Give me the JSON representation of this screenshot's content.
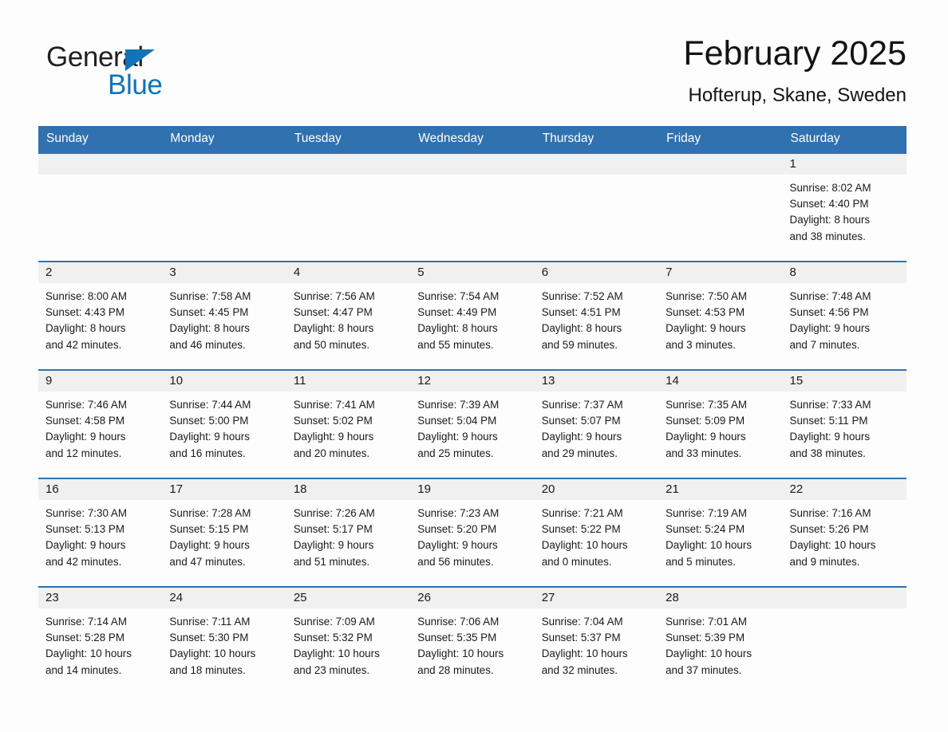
{
  "brand": {
    "word_one": "General",
    "word_two": "Blue",
    "triangle_color": "#1273b8"
  },
  "header": {
    "title": "February 2025",
    "subtitle": "Hofterup, Skane, Sweden"
  },
  "theme": {
    "header_blue": "#3071b0",
    "daynum_band": "#f0f0f0",
    "page_bg": "#fdfdfd",
    "text": "#1a1a1a"
  },
  "weekdays": [
    "Sunday",
    "Monday",
    "Tuesday",
    "Wednesday",
    "Thursday",
    "Friday",
    "Saturday"
  ],
  "weeks": [
    [
      {
        "day": "",
        "lines": []
      },
      {
        "day": "",
        "lines": []
      },
      {
        "day": "",
        "lines": []
      },
      {
        "day": "",
        "lines": []
      },
      {
        "day": "",
        "lines": []
      },
      {
        "day": "",
        "lines": []
      },
      {
        "day": "1",
        "lines": [
          "Sunrise: 8:02 AM",
          "Sunset: 4:40 PM",
          "Daylight: 8 hours",
          "and 38 minutes."
        ]
      }
    ],
    [
      {
        "day": "2",
        "lines": [
          "Sunrise: 8:00 AM",
          "Sunset: 4:43 PM",
          "Daylight: 8 hours",
          "and 42 minutes."
        ]
      },
      {
        "day": "3",
        "lines": [
          "Sunrise: 7:58 AM",
          "Sunset: 4:45 PM",
          "Daylight: 8 hours",
          "and 46 minutes."
        ]
      },
      {
        "day": "4",
        "lines": [
          "Sunrise: 7:56 AM",
          "Sunset: 4:47 PM",
          "Daylight: 8 hours",
          "and 50 minutes."
        ]
      },
      {
        "day": "5",
        "lines": [
          "Sunrise: 7:54 AM",
          "Sunset: 4:49 PM",
          "Daylight: 8 hours",
          "and 55 minutes."
        ]
      },
      {
        "day": "6",
        "lines": [
          "Sunrise: 7:52 AM",
          "Sunset: 4:51 PM",
          "Daylight: 8 hours",
          "and 59 minutes."
        ]
      },
      {
        "day": "7",
        "lines": [
          "Sunrise: 7:50 AM",
          "Sunset: 4:53 PM",
          "Daylight: 9 hours",
          "and 3 minutes."
        ]
      },
      {
        "day": "8",
        "lines": [
          "Sunrise: 7:48 AM",
          "Sunset: 4:56 PM",
          "Daylight: 9 hours",
          "and 7 minutes."
        ]
      }
    ],
    [
      {
        "day": "9",
        "lines": [
          "Sunrise: 7:46 AM",
          "Sunset: 4:58 PM",
          "Daylight: 9 hours",
          "and 12 minutes."
        ]
      },
      {
        "day": "10",
        "lines": [
          "Sunrise: 7:44 AM",
          "Sunset: 5:00 PM",
          "Daylight: 9 hours",
          "and 16 minutes."
        ]
      },
      {
        "day": "11",
        "lines": [
          "Sunrise: 7:41 AM",
          "Sunset: 5:02 PM",
          "Daylight: 9 hours",
          "and 20 minutes."
        ]
      },
      {
        "day": "12",
        "lines": [
          "Sunrise: 7:39 AM",
          "Sunset: 5:04 PM",
          "Daylight: 9 hours",
          "and 25 minutes."
        ]
      },
      {
        "day": "13",
        "lines": [
          "Sunrise: 7:37 AM",
          "Sunset: 5:07 PM",
          "Daylight: 9 hours",
          "and 29 minutes."
        ]
      },
      {
        "day": "14",
        "lines": [
          "Sunrise: 7:35 AM",
          "Sunset: 5:09 PM",
          "Daylight: 9 hours",
          "and 33 minutes."
        ]
      },
      {
        "day": "15",
        "lines": [
          "Sunrise: 7:33 AM",
          "Sunset: 5:11 PM",
          "Daylight: 9 hours",
          "and 38 minutes."
        ]
      }
    ],
    [
      {
        "day": "16",
        "lines": [
          "Sunrise: 7:30 AM",
          "Sunset: 5:13 PM",
          "Daylight: 9 hours",
          "and 42 minutes."
        ]
      },
      {
        "day": "17",
        "lines": [
          "Sunrise: 7:28 AM",
          "Sunset: 5:15 PM",
          "Daylight: 9 hours",
          "and 47 minutes."
        ]
      },
      {
        "day": "18",
        "lines": [
          "Sunrise: 7:26 AM",
          "Sunset: 5:17 PM",
          "Daylight: 9 hours",
          "and 51 minutes."
        ]
      },
      {
        "day": "19",
        "lines": [
          "Sunrise: 7:23 AM",
          "Sunset: 5:20 PM",
          "Daylight: 9 hours",
          "and 56 minutes."
        ]
      },
      {
        "day": "20",
        "lines": [
          "Sunrise: 7:21 AM",
          "Sunset: 5:22 PM",
          "Daylight: 10 hours",
          "and 0 minutes."
        ]
      },
      {
        "day": "21",
        "lines": [
          "Sunrise: 7:19 AM",
          "Sunset: 5:24 PM",
          "Daylight: 10 hours",
          "and 5 minutes."
        ]
      },
      {
        "day": "22",
        "lines": [
          "Sunrise: 7:16 AM",
          "Sunset: 5:26 PM",
          "Daylight: 10 hours",
          "and 9 minutes."
        ]
      }
    ],
    [
      {
        "day": "23",
        "lines": [
          "Sunrise: 7:14 AM",
          "Sunset: 5:28 PM",
          "Daylight: 10 hours",
          "and 14 minutes."
        ]
      },
      {
        "day": "24",
        "lines": [
          "Sunrise: 7:11 AM",
          "Sunset: 5:30 PM",
          "Daylight: 10 hours",
          "and 18 minutes."
        ]
      },
      {
        "day": "25",
        "lines": [
          "Sunrise: 7:09 AM",
          "Sunset: 5:32 PM",
          "Daylight: 10 hours",
          "and 23 minutes."
        ]
      },
      {
        "day": "26",
        "lines": [
          "Sunrise: 7:06 AM",
          "Sunset: 5:35 PM",
          "Daylight: 10 hours",
          "and 28 minutes."
        ]
      },
      {
        "day": "27",
        "lines": [
          "Sunrise: 7:04 AM",
          "Sunset: 5:37 PM",
          "Daylight: 10 hours",
          "and 32 minutes."
        ]
      },
      {
        "day": "28",
        "lines": [
          "Sunrise: 7:01 AM",
          "Sunset: 5:39 PM",
          "Daylight: 10 hours",
          "and 37 minutes."
        ]
      },
      {
        "day": "",
        "lines": []
      }
    ]
  ]
}
